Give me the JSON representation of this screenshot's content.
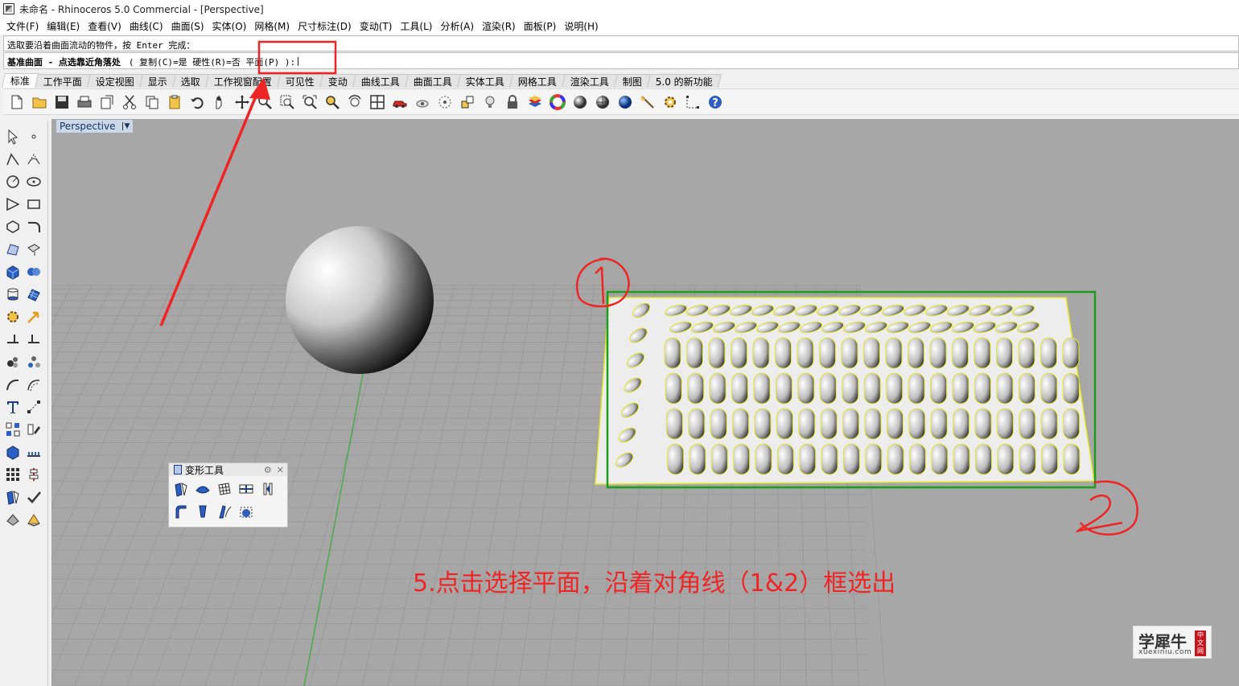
{
  "window": {
    "title": "未命名 - Rhinoceros 5.0 Commercial - [Perspective]"
  },
  "menubar": {
    "items": [
      "文件(F)",
      "编辑(E)",
      "查看(V)",
      "曲线(C)",
      "曲面(S)",
      "实体(O)",
      "网格(M)",
      "尺寸标注(D)",
      "变动(T)",
      "工具(L)",
      "分析(A)",
      "渲染(R)",
      "面板(P)",
      "说明(H)"
    ]
  },
  "command": {
    "history": "选取要沿着曲面流动的物件，按 Enter 完成：",
    "prompt": "基准曲面 - 点选靠近角落处",
    "options": "( 复制(C)=是  硬性(R)=否  平面(P) ):",
    "cursor": "|"
  },
  "tabs": {
    "items": [
      "标准",
      "工作平面",
      "设定视图",
      "显示",
      "选取",
      "工作视窗配置",
      "可见性",
      "变动",
      "曲线工具",
      "曲面工具",
      "实体工具",
      "网格工具",
      "渲染工具",
      "制图",
      "5.0 的新功能"
    ],
    "active_index": 0
  },
  "toolbar": {
    "icons": [
      "new-file-icon",
      "open-file-icon",
      "save-icon",
      "print-icon",
      "import-icon",
      "cut-icon",
      "copy-icon",
      "paste-icon",
      "undo-icon",
      "pan-hand-icon",
      "rotate-view-icon",
      "zoom-dynamic-icon",
      "zoom-window-icon",
      "zoom-extents-icon",
      "zoom-selected-icon",
      "undo-view-icon",
      "four-viewports-icon",
      "car-shade-icon",
      "hide-icon",
      "show-icon",
      "select-layer-icon",
      "light-bulb-icon",
      "lock-icon",
      "layer-icon",
      "color-wheel-icon",
      "material-sphere-icon",
      "render-sphere-icon",
      "blue-sphere-icon",
      "wand-icon",
      "gear-settings-icon",
      "dimension-icon",
      "help-icon"
    ]
  },
  "viewport": {
    "label": "Perspective",
    "dropdown": "▼"
  },
  "float_panel": {
    "title": "变形工具",
    "gear": "⚙",
    "close": "✕"
  },
  "annotations": {
    "instruction": "5.点击选择平面，沿着对角线（1&2）框选出",
    "marker_1": "①",
    "marker_2": "②",
    "highlight_color": "#ef2424",
    "selection_color": "#1e9c1e"
  },
  "watermark": {
    "main": "学犀牛",
    "sub": "xuexiniu.com",
    "seal": "中文网"
  }
}
